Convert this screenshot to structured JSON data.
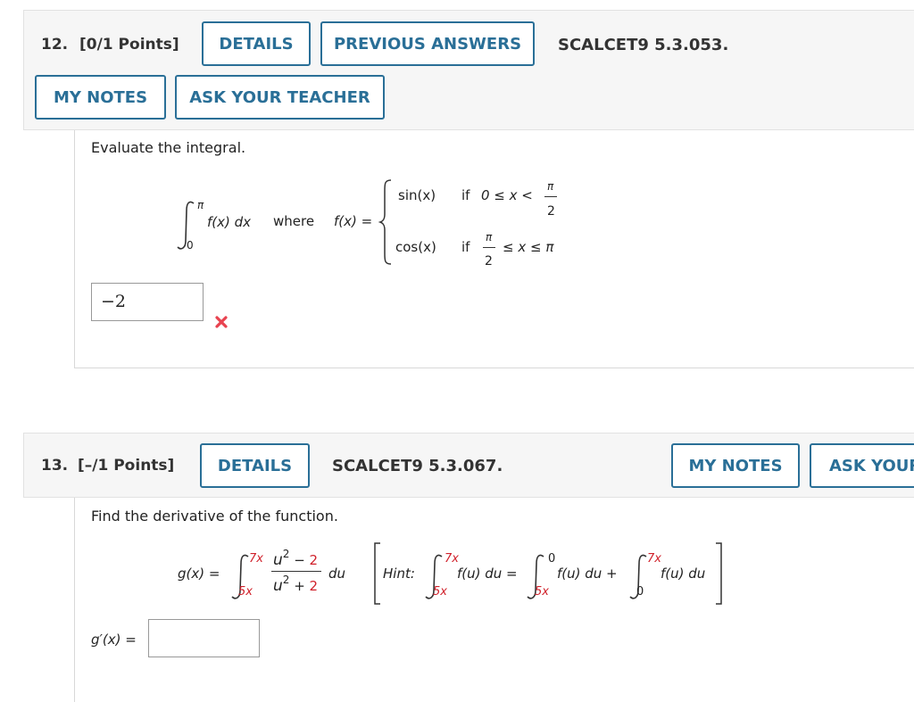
{
  "q12": {
    "number": "12.",
    "points": "[0/1 Points]",
    "details": "DETAILS",
    "previous_answers": "PREVIOUS ANSWERS",
    "reference": "SCALCET9 5.3.053.",
    "my_notes": "MY NOTES",
    "ask_teacher": "ASK YOUR TEACHER",
    "prompt": "Evaluate the integral.",
    "integral": {
      "lower": "0",
      "upper": "π",
      "integrand": "f(x) dx",
      "where": "where",
      "fx": "f(x) ="
    },
    "cases": [
      {
        "expr": "sin(x)",
        "cond_if": "if",
        "cond_left": "0 ≤ x <",
        "frac_num": "π",
        "frac_den": "2"
      },
      {
        "expr": "cos(x)",
        "cond_if": "if",
        "frac_num": "π",
        "frac_den": "2",
        "cond_right": "≤ x ≤ π"
      }
    ],
    "answer_value": "−2",
    "status": "incorrect",
    "status_color": "#e8424f"
  },
  "q13": {
    "number": "13.",
    "points": "[–/1 Points]",
    "details": "DETAILS",
    "reference": "SCALCET9 5.3.067.",
    "my_notes": "MY NOTES",
    "ask_teacher": "ASK YOUR",
    "prompt": "Find the derivative of the function.",
    "gx": "g(x) =",
    "upper": "7x",
    "lower": "5x",
    "num_base": "u",
    "num_exp": "2",
    "num_minus": " − ",
    "num_const": "2",
    "den_base": "u",
    "den_exp": "2",
    "den_plus": " + ",
    "den_const": "2",
    "du": "du",
    "hint_label": "Hint:",
    "hint_upper1": "7x",
    "hint_lower1": "5x",
    "hint_term1": "f(u) du =",
    "hint_upper2": "0",
    "hint_lower2": "5x",
    "hint_term2": "f(u) du +",
    "hint_upper3": "7x",
    "hint_lower3": "0",
    "hint_term3": "f(u) du",
    "answer_label": "g′(x) =",
    "answer_value": ""
  },
  "colors": {
    "accent": "#2a6f97",
    "red_const": "#d0212b"
  }
}
